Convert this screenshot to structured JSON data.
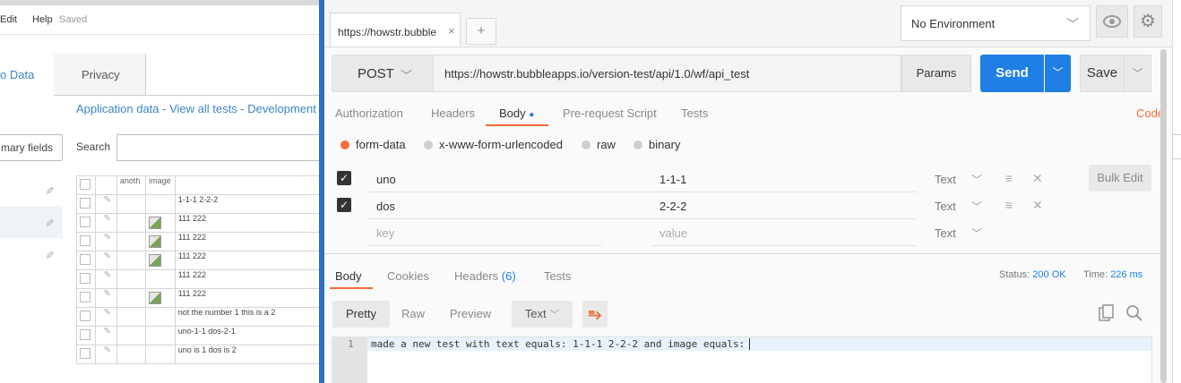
{
  "background_app": {
    "menu": {
      "edit": "Edit",
      "help": "Help",
      "status": "Saved"
    },
    "tabs": {
      "data": "o Data",
      "privacy": "Privacy"
    },
    "app_data_link": "Application data - View all tests - Development versi",
    "primary_fields_button": "mary fields",
    "search_label": "Search",
    "table": {
      "headers": [
        "anoth",
        "image"
      ],
      "rows": [
        {
          "text": "1-1-1 2-2-2",
          "image": false
        },
        {
          "text": "111 222",
          "image": true
        },
        {
          "text": "111 222",
          "image": true
        },
        {
          "text": "111 222",
          "image": true
        },
        {
          "text": "111 222",
          "image": false
        },
        {
          "text": "111 222",
          "image": true
        },
        {
          "text": "not the number 1 this is a 2",
          "image": false
        },
        {
          "text": "uno-1-1 dos-2-1",
          "image": false
        },
        {
          "text": "uno is 1 dos is 2",
          "image": false
        }
      ]
    }
  },
  "postman": {
    "request_tab": {
      "label": "https://howstr.bubble",
      "close": "×"
    },
    "new_tab": "+",
    "environment": {
      "selected": "No Environment"
    },
    "request": {
      "method": "POST",
      "url": "https://howstr.bubbleapps.io/version-test/api/1.0/wf/api_test",
      "params_label": "Params",
      "send_label": "Send",
      "save_label": "Save"
    },
    "subtabs": {
      "authorization": "Authorization",
      "headers": "Headers",
      "body": "Body",
      "prerequest": "Pre-request Script",
      "tests": "Tests",
      "code": "Code"
    },
    "body_modes": {
      "form_data": "form-data",
      "urlencoded": "x-www-form-urlencoded",
      "raw": "raw",
      "binary": "binary",
      "selected": "form-data"
    },
    "form_rows": [
      {
        "key": "uno",
        "value": "1-1-1",
        "type": "Text",
        "checked": true
      },
      {
        "key": "dos",
        "value": "2-2-2",
        "type": "Text",
        "checked": true
      }
    ],
    "empty_row": {
      "key_placeholder": "key",
      "value_placeholder": "value",
      "type": "Text"
    },
    "bulk_edit": "Bulk Edit",
    "response": {
      "tabs": {
        "body": "Body",
        "cookies": "Cookies",
        "headers": "Headers",
        "headers_count": "(6)",
        "tests": "Tests"
      },
      "status_label": "Status:",
      "status_value": "200 OK",
      "time_label": "Time:",
      "time_value": "226 ms",
      "format_buttons": {
        "pretty": "Pretty",
        "raw": "Raw",
        "preview": "Preview",
        "text_select": "Text"
      },
      "line_number": "1",
      "content": "made a new test with text equals: 1-1-1 2-2-2 and image equals: "
    }
  },
  "colors": {
    "accent_orange": "#f26b3a",
    "send_blue": "#1f7fe5",
    "window_border": "#2d6fc7"
  }
}
